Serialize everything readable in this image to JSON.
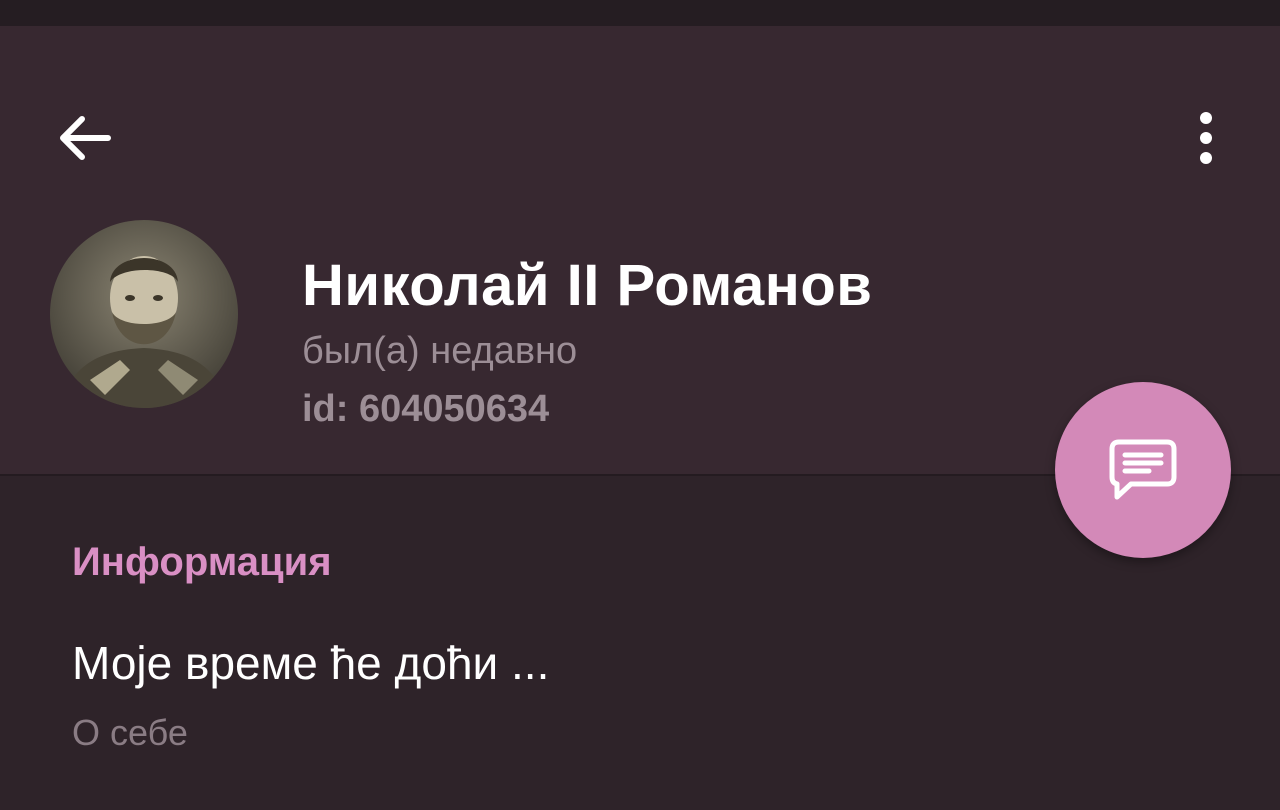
{
  "profile": {
    "name": "Николай II Романов",
    "status": "был(а) недавно",
    "id": "id: 604050634"
  },
  "info": {
    "section_title": "Информация",
    "bio": "Моје време ће доћи ...",
    "bio_caption": "О себе"
  },
  "icons": {
    "back": "arrow-left-icon",
    "menu": "more-vertical-icon",
    "fab": "message-icon"
  },
  "colors": {
    "header_bg": "#372830",
    "content_bg": "#2e2329",
    "accent": "#d389b8",
    "section_title": "#d98fc4"
  }
}
